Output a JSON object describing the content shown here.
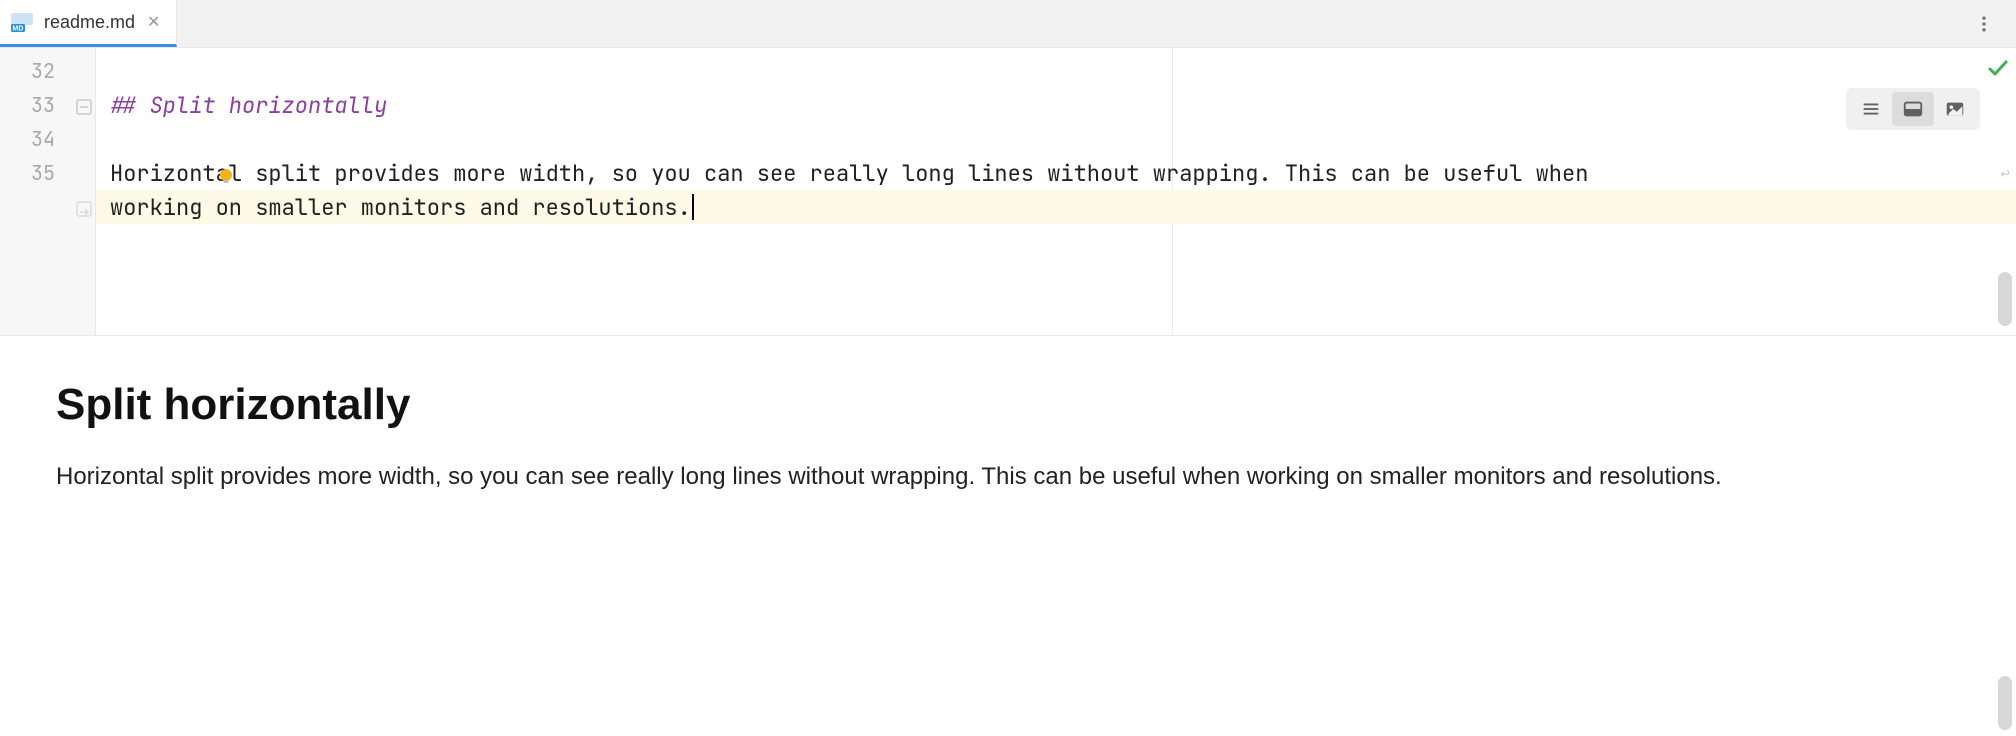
{
  "tab": {
    "filename": "readme.md",
    "icon": "markdown-file-icon",
    "active": true
  },
  "editor": {
    "line_numbers": [
      "32",
      "33",
      "34",
      "35"
    ],
    "lines": {
      "l32": "",
      "l33": "## Split horizontally",
      "l34": "",
      "l35a": "Horizontal split provides more width, so you can see really long lines without wrapping. This can be useful when ",
      "l35b": "working on smaller monitors and resolutions."
    },
    "status_icon": "check-ok",
    "view_modes": {
      "source": "editor-only",
      "split": "editor-and-preview",
      "preview": "preview-only",
      "selected": "split"
    }
  },
  "preview": {
    "heading": "Split horizontally",
    "body": "Horizontal split provides more width, so you can see really long lines without wrapping. This can be useful when working on smaller monitors and resolutions."
  }
}
